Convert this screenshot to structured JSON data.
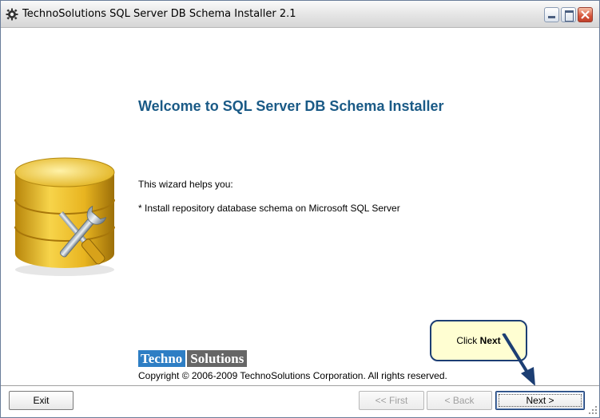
{
  "window": {
    "title": "TechnoSolutions SQL Server DB Schema Installer 2.1",
    "icons": {
      "app": "gear-icon",
      "minimize": "minimize-icon",
      "maximize": "maximize-icon",
      "close": "close-icon"
    }
  },
  "main": {
    "heading": "Welcome to SQL Server DB Schema Installer",
    "intro": "This wizard helps you:",
    "bullet": "* Install repository database schema on Microsoft SQL Server",
    "illustration": "database-tools-icon"
  },
  "branding": {
    "logo_part1": "Techno",
    "logo_part2": "Solutions",
    "copyright": "Copyright © 2006-2009  TechnoSolutions Corporation. All rights reserved."
  },
  "callout": {
    "prefix": "Click ",
    "emphasis": "Next"
  },
  "buttons": {
    "exit": "Exit",
    "first": "<< First",
    "back": "< Back",
    "next": "Next >"
  },
  "colors": {
    "heading": "#1a5a86",
    "logo_blue": "#2e7ec4",
    "logo_gray": "#666666",
    "callout_bg": "#fffed2",
    "callout_border": "#1c3e73"
  }
}
